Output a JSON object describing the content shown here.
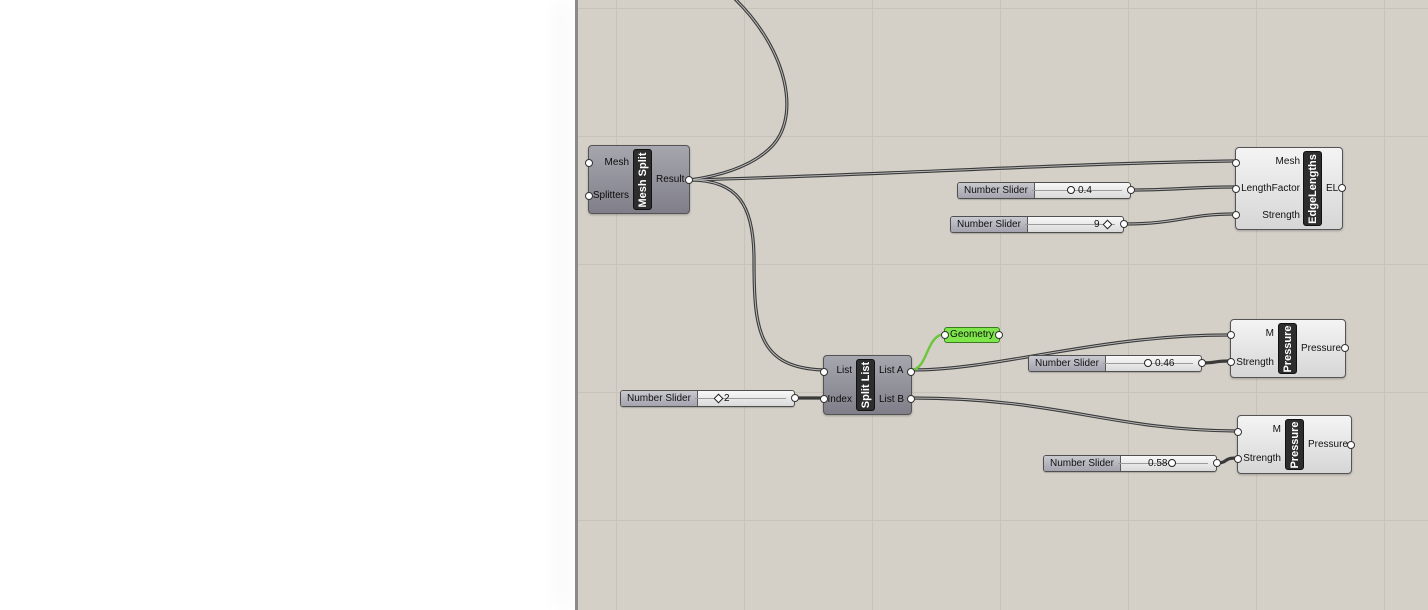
{
  "components": {
    "mesh_split": {
      "title": "Mesh Split",
      "inputs": [
        "Mesh",
        "Splitters"
      ],
      "outputs": [
        "Result"
      ]
    },
    "edge_lengths": {
      "title": "EdgeLengths",
      "inputs": [
        "Mesh",
        "LengthFactor",
        "Strength"
      ],
      "outputs": [
        "EL"
      ]
    },
    "split_list": {
      "title": "Split List",
      "inputs": [
        "List",
        "Index"
      ],
      "outputs": [
        "List A",
        "List B"
      ]
    },
    "pressure_1": {
      "title": "Pressure",
      "inputs": [
        "M",
        "Strength"
      ],
      "outputs": [
        "Pressure"
      ]
    },
    "pressure_2": {
      "title": "Pressure",
      "inputs": [
        "M",
        "Strength"
      ],
      "outputs": [
        "Pressure"
      ]
    }
  },
  "sliders": {
    "length_factor": {
      "label": "Number Slider",
      "value": "0.4"
    },
    "strength_el": {
      "label": "Number Slider",
      "value": "9"
    },
    "index": {
      "label": "Number Slider",
      "value": "2"
    },
    "strength_p1": {
      "label": "Number Slider",
      "value": "0.46"
    },
    "strength_p2": {
      "label": "Number Slider",
      "value": "0.58"
    }
  },
  "panel": {
    "label": "Geometry"
  },
  "colors": {
    "mesh_left": "#c1d89c",
    "mesh_right": "#fdbcbd",
    "mesh_outline": "#8b3a2a",
    "canvas_bg": "#d4d0c8",
    "panel_green": "#7ee54a"
  }
}
